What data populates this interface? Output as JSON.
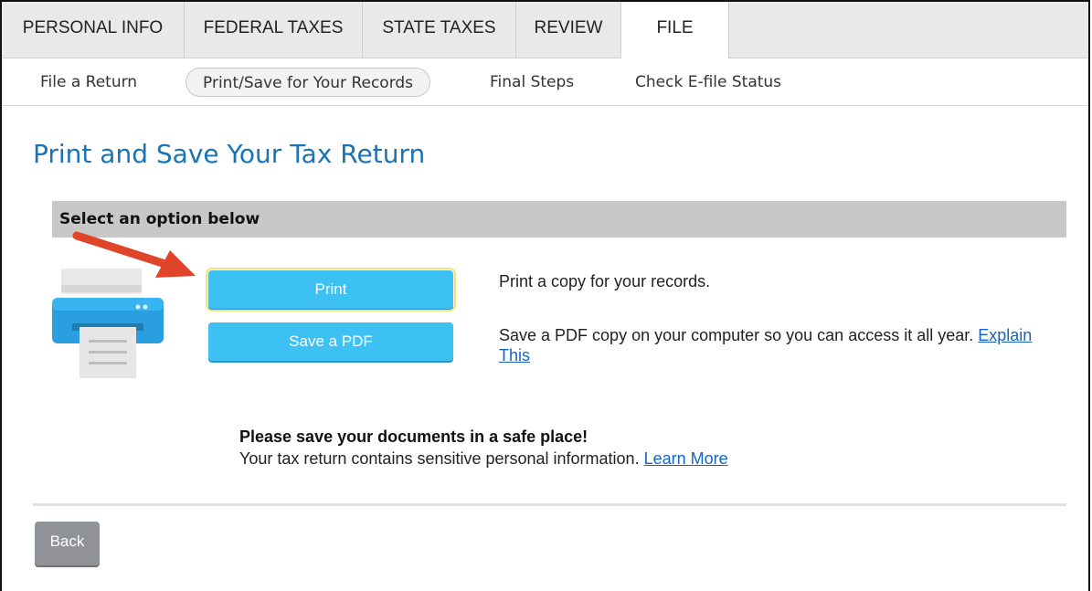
{
  "tabs": [
    {
      "label": "PERSONAL INFO"
    },
    {
      "label": "FEDERAL TAXES"
    },
    {
      "label": "STATE TAXES"
    },
    {
      "label": "REVIEW"
    },
    {
      "label": "FILE",
      "active": true
    }
  ],
  "subtabs": [
    {
      "label": "File a Return"
    },
    {
      "label": "Print/Save for Your Records",
      "active": true
    },
    {
      "label": "Final Steps"
    },
    {
      "label": "Check E-file Status"
    }
  ],
  "page": {
    "title": "Print and Save Your Tax Return",
    "option_bar": "Select an option below"
  },
  "buttons": {
    "print": "Print",
    "save_pdf": "Save a PDF",
    "back": "Back"
  },
  "descriptions": {
    "print": "Print a copy for your records.",
    "save_pdf": "Save a PDF copy on your computer so you can access it all year.",
    "save_pdf_link": "Explain This"
  },
  "notice": {
    "heading": "Please save your documents in a safe place!",
    "body": "Your tax return contains sensitive personal information.",
    "link": "Learn More"
  },
  "icons": {
    "printer": "printer-icon",
    "arrow": "arrow-annotation"
  },
  "colors": {
    "title_blue": "#1a73b6",
    "button_blue": "#3dc1f3",
    "link_blue": "#1565c0",
    "back_gray": "#8f9296",
    "arrow_red": "#e0452a"
  }
}
